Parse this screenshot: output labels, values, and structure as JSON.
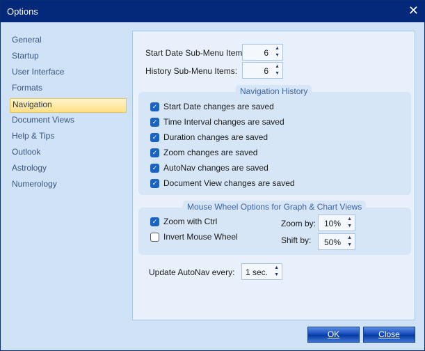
{
  "window": {
    "title": "Options",
    "close_icon": "close-icon"
  },
  "sidebar": {
    "items": [
      "General",
      "Startup",
      "User Interface",
      "Formats",
      "Navigation",
      "Document Views",
      "Help & Tips",
      "Outlook",
      "Astrology",
      "Numerology"
    ],
    "selected": "Navigation"
  },
  "main": {
    "start_date_label": "Start  Date  Sub-Menu Item",
    "start_date_value": "6",
    "history_label": "History Sub-Menu Items:",
    "history_value": "6",
    "nav_history": {
      "title": "Navigation History",
      "items": [
        {
          "label": "Start Date changes are saved",
          "checked": true
        },
        {
          "label": "Time Interval changes are saved",
          "checked": true
        },
        {
          "label": "Duration changes are saved",
          "checked": true
        },
        {
          "label": "Zoom changes are saved",
          "checked": true
        },
        {
          "label": "AutoNav changes are saved",
          "checked": true
        },
        {
          "label": "Document View changes are saved",
          "checked": true
        }
      ]
    },
    "mouse_wheel": {
      "title": "Mouse Wheel Options for Graph & Chart Views",
      "zoom_ctrl": "Zoom with Ctrl",
      "zoom_ctrl_checked": true,
      "invert": "Invert Mouse Wheel",
      "invert_checked": false,
      "zoom_by_label": "Zoom by:",
      "zoom_by_value": "10%",
      "shift_by_label": "Shift by:",
      "shift_by_value": "50%"
    },
    "autonav_label": "Update AutoNav every:",
    "autonav_value": "1 sec."
  },
  "buttons": {
    "ok": "OK",
    "close": "Close"
  },
  "colors": {
    "title_bar": "#04297a",
    "accent": "#1a63c0",
    "selection": "#ffe088"
  }
}
